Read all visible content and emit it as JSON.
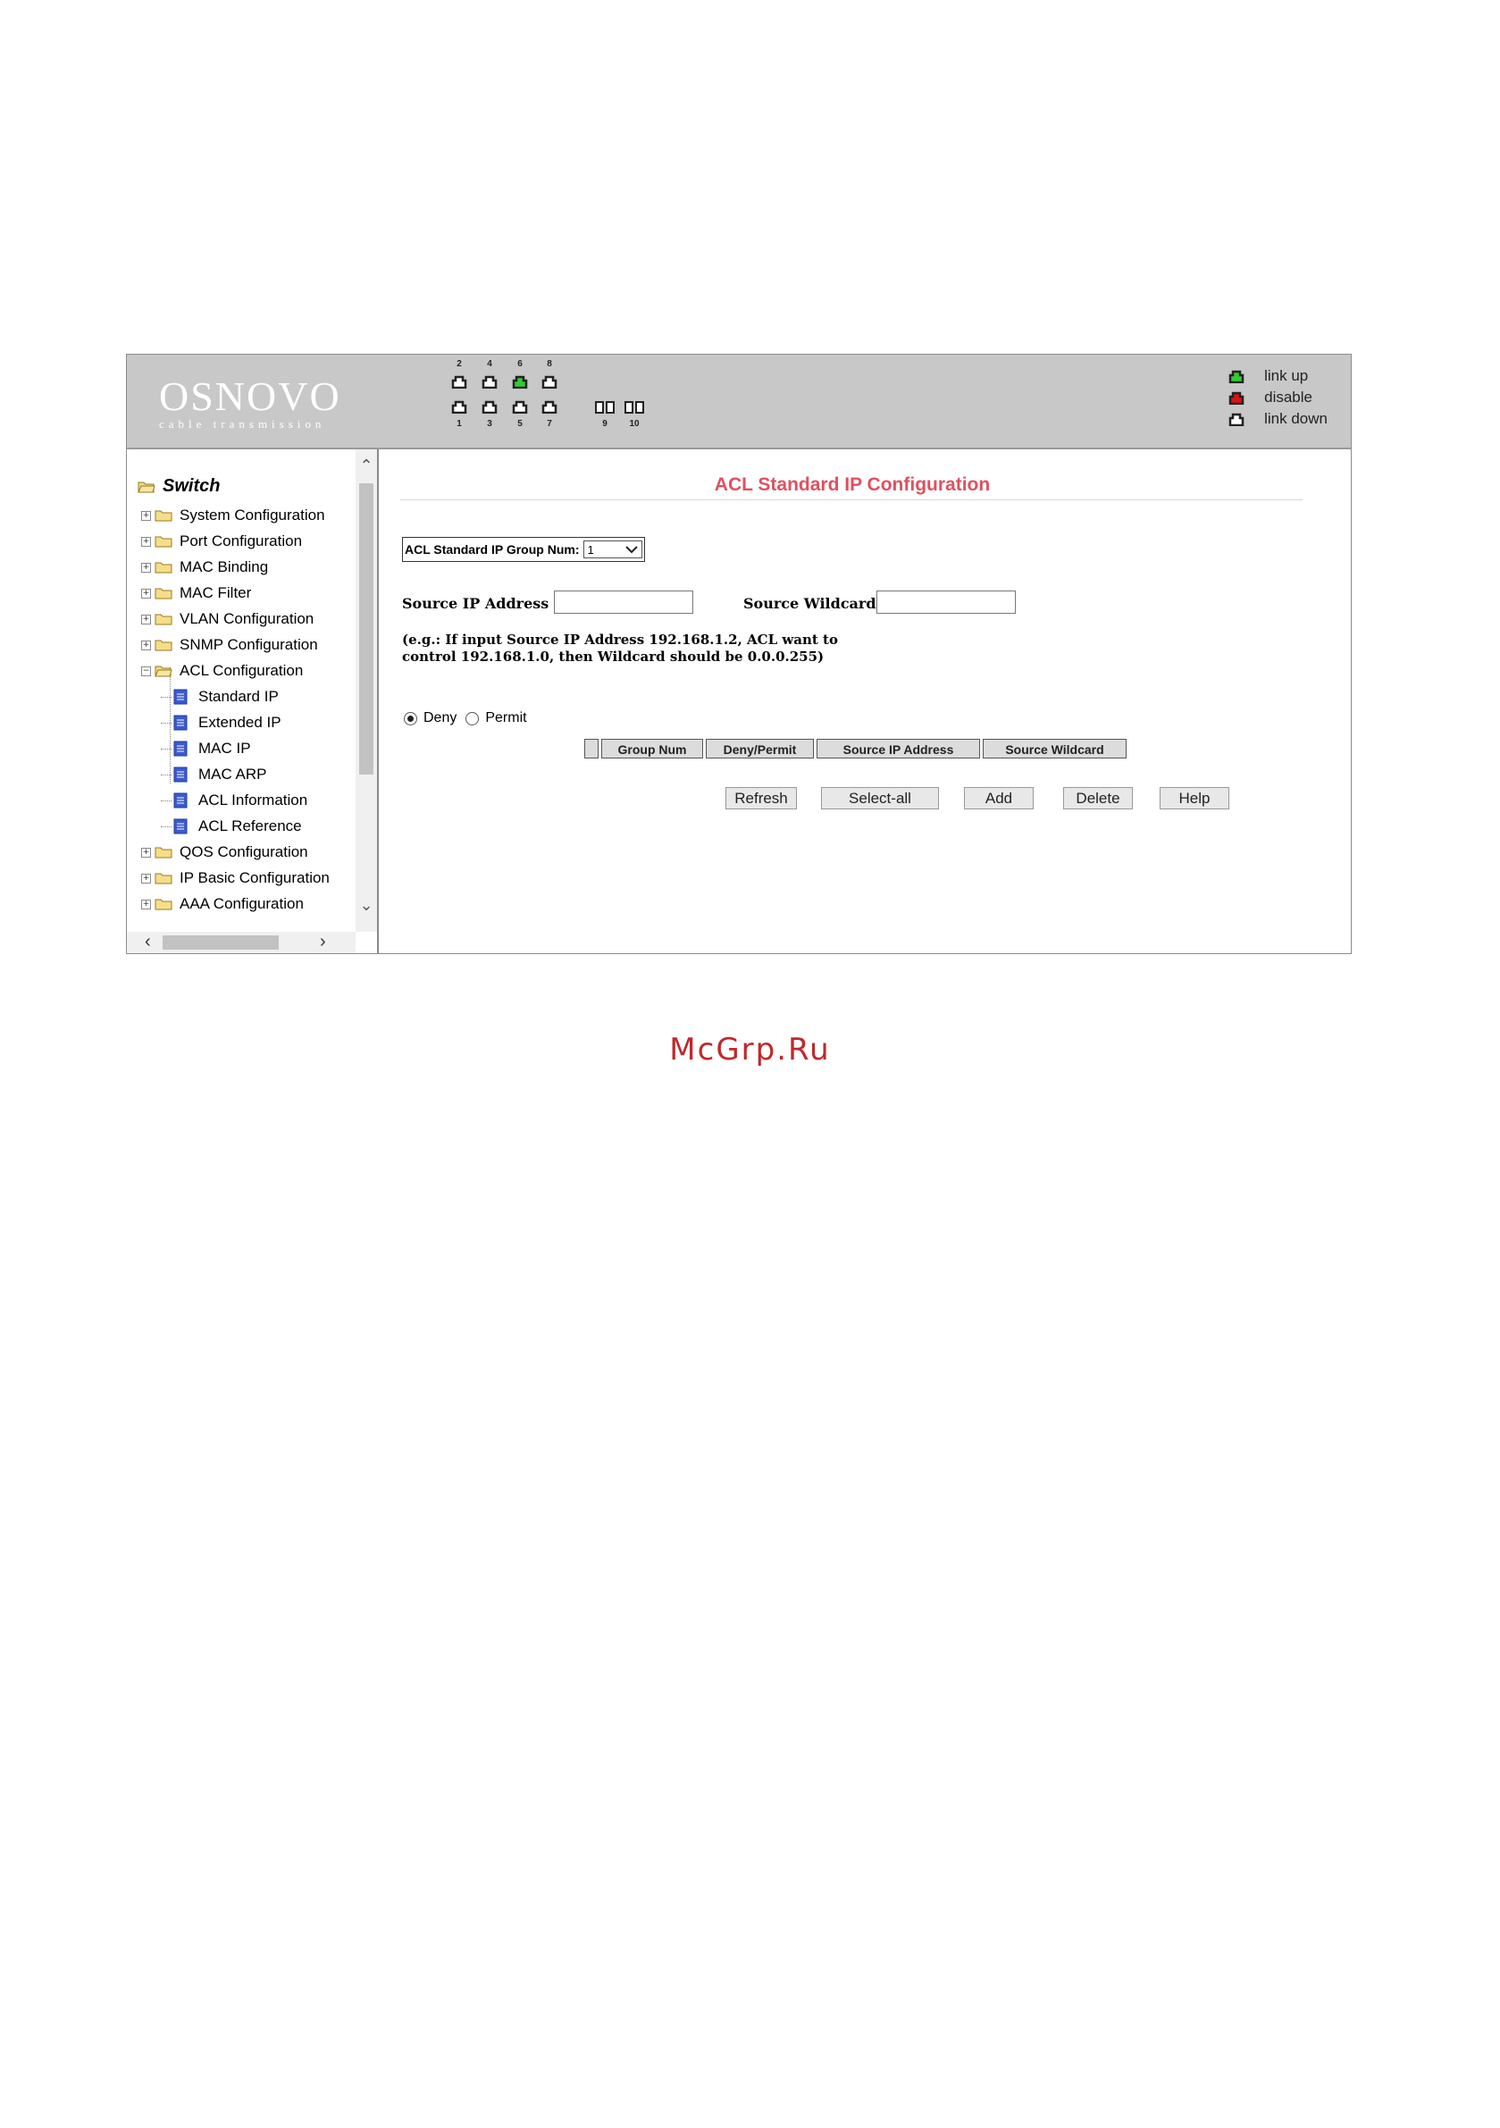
{
  "brand": {
    "name": "OSNOVO",
    "tagline": "cable transmission"
  },
  "ports": {
    "top_numbers": [
      "2",
      "4",
      "6",
      "8"
    ],
    "bottom_numbers": [
      "1",
      "3",
      "5",
      "7",
      "9",
      "10"
    ],
    "status": {
      "2": "link down",
      "4": "link down",
      "6": "link up",
      "8": "link down",
      "1": "link down",
      "3": "link down",
      "5": "link down",
      "7": "link down",
      "9": "link down",
      "10": "link down"
    }
  },
  "legend": [
    {
      "label": "link up",
      "color": "#22aa22"
    },
    {
      "label": "disable",
      "color": "#cc1111"
    },
    {
      "label": "link down",
      "color": "#222222"
    }
  ],
  "sidebar": {
    "root": "Switch",
    "items": [
      {
        "label": "System Configuration",
        "type": "folder"
      },
      {
        "label": "Port Configuration",
        "type": "folder"
      },
      {
        "label": "MAC Binding",
        "type": "folder"
      },
      {
        "label": "MAC Filter",
        "type": "folder"
      },
      {
        "label": "VLAN Configuration",
        "type": "folder"
      },
      {
        "label": "SNMP Configuration",
        "type": "folder"
      },
      {
        "label": "ACL Configuration",
        "type": "folder-open"
      },
      {
        "label": "Standard IP",
        "type": "page"
      },
      {
        "label": "Extended IP",
        "type": "page"
      },
      {
        "label": "MAC IP",
        "type": "page"
      },
      {
        "label": "MAC ARP",
        "type": "page"
      },
      {
        "label": "ACL Information",
        "type": "page"
      },
      {
        "label": "ACL Reference",
        "type": "page"
      },
      {
        "label": "QOS Configuration",
        "type": "folder"
      },
      {
        "label": "IP Basic Configuration",
        "type": "folder"
      },
      {
        "label": "AAA Configuration",
        "type": "folder"
      }
    ]
  },
  "main": {
    "title": "ACL Standard IP Configuration",
    "group_num_label": "ACL Standard IP Group Num:",
    "group_num_value": "1",
    "source_ip_label": "Source IP Address",
    "source_ip_value": "",
    "source_wildcard_label": "Source Wildcard",
    "source_wildcard_value": "",
    "example_text": "(e.g.: If input Source IP Address 192.168.1.2, ACL want to control 192.168.1.0, then Wildcard should be 0.0.0.255)",
    "radio": {
      "deny": "Deny",
      "permit": "Permit",
      "selected": "Deny"
    },
    "table_headers": [
      "",
      "Group Num",
      "Deny/Permit",
      "Source IP Address",
      "Source Wildcard"
    ],
    "buttons": [
      "Refresh",
      "Select-all",
      "Add",
      "Delete",
      "Help"
    ]
  },
  "watermark": "McGrp.Ru"
}
